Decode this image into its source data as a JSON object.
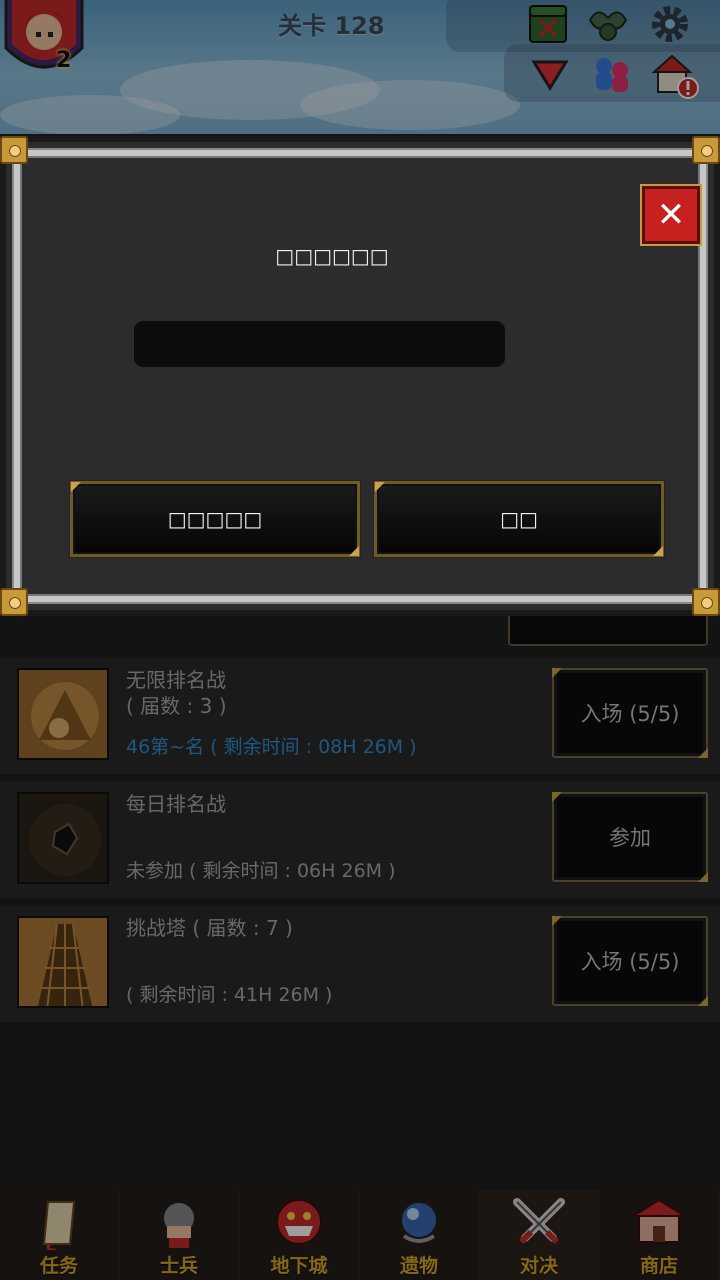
{
  "hud": {
    "stage_title": "关卡 128",
    "avatar_level": "2",
    "icons": [
      "chest-icon",
      "angel-icon",
      "gear-icon",
      "triangle-down-icon",
      "party-icon",
      "house-alert-icon"
    ]
  },
  "list": {
    "rows": [
      {
        "title": "无限排名战",
        "subtitle": "( 届数 : 3 )",
        "status": "46第~名 ( 剩余时间 : 08H 26M )",
        "button": "入场 (5/5)"
      },
      {
        "title": "每日排名战",
        "subtitle": "",
        "status": "未参加 ( 剩余时间 : 06H 26M )",
        "button": "参加"
      },
      {
        "title": "挑战塔 ( 届数 : 7 )",
        "subtitle": "",
        "status": "( 剩余时间 : 41H 26M )",
        "button": "入场 (5/5)"
      }
    ]
  },
  "nav": {
    "items": [
      {
        "label": "任务",
        "icon": "scroll-icon"
      },
      {
        "label": "士兵",
        "icon": "soldier-icon"
      },
      {
        "label": "地下城",
        "icon": "monster-icon"
      },
      {
        "label": "遗物",
        "icon": "orb-icon"
      },
      {
        "label": "对决",
        "icon": "crossed-swords-icon"
      },
      {
        "label": "商店",
        "icon": "shop-icon"
      }
    ],
    "active_index": 4
  },
  "modal": {
    "title": "□□□□□□",
    "input_value": "",
    "input_placeholder": "",
    "left_button": "□□□□□",
    "right_button": "□□",
    "close_label": "✕"
  },
  "colors": {
    "accent_gold": "#d7a826",
    "close_red": "#c7211f",
    "status_blue": "#2f8fcf"
  }
}
